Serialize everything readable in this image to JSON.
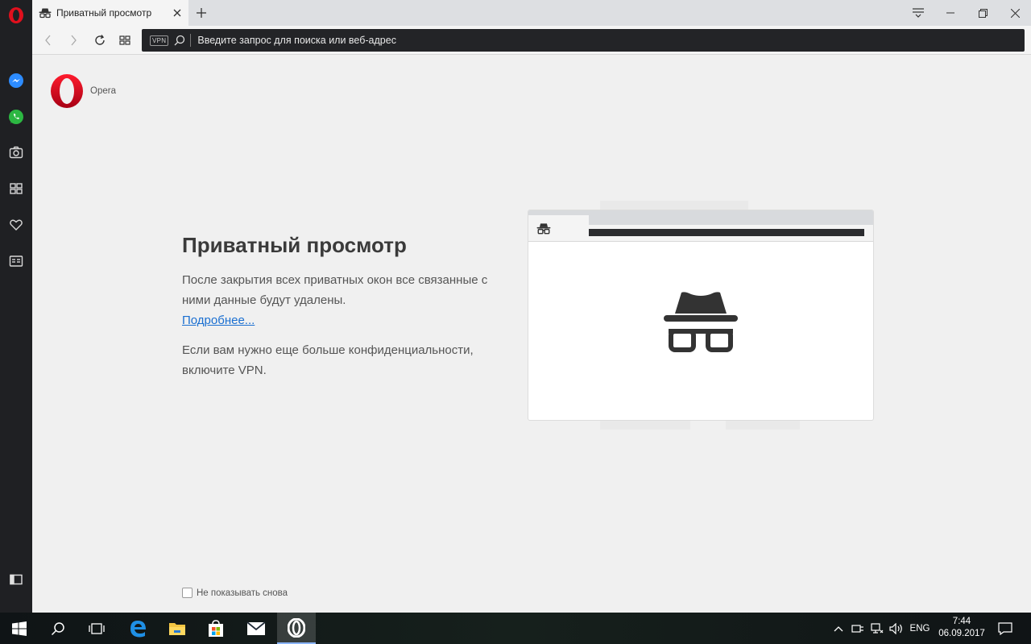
{
  "browser": {
    "tab": {
      "title": "Приватный просмотр",
      "icon": "incognito-icon"
    },
    "address_bar": {
      "vpn_badge": "VPN",
      "placeholder": "Введите запрос для поиска или веб-адрес"
    },
    "window_controls": [
      "easy-setup-icon",
      "minimize-icon",
      "restore-icon",
      "close-icon"
    ]
  },
  "sidebar": {
    "items": [
      {
        "name": "opera-menu",
        "icon": "opera-logo-icon"
      },
      {
        "name": "messenger",
        "icon": "messenger-icon"
      },
      {
        "name": "whatsapp",
        "icon": "whatsapp-icon"
      },
      {
        "name": "snapshot",
        "icon": "camera-icon"
      },
      {
        "name": "speed-dial",
        "icon": "grid-icon"
      },
      {
        "name": "bookmarks",
        "icon": "heart-icon"
      },
      {
        "name": "news",
        "icon": "news-icon"
      },
      {
        "name": "toggle-sidebar",
        "icon": "sidebar-toggle-icon"
      }
    ]
  },
  "page": {
    "logo_label": "Opera",
    "heading": "Приватный просмотр",
    "paragraph1": "После закрытия всех приватных окон все связанные с ними данные будут удалены.",
    "more_link": "Подробнее...",
    "paragraph2": "Если вам нужно еще больше конфиденциальности, включите VPN.",
    "dont_show_again": "Не показывать снова"
  },
  "taskbar": {
    "apps": [
      "windows-start-icon",
      "search-icon",
      "task-view-icon",
      "edge-icon",
      "file-explorer-icon",
      "store-icon",
      "mail-icon",
      "opera-icon"
    ],
    "language": "ENG",
    "time": "7:44",
    "date": "06.09.2017"
  },
  "colors": {
    "sidebar": "#1f2023",
    "address_bar": "#232427",
    "opera_red": "#d0021b",
    "link": "#1a6fd1"
  }
}
